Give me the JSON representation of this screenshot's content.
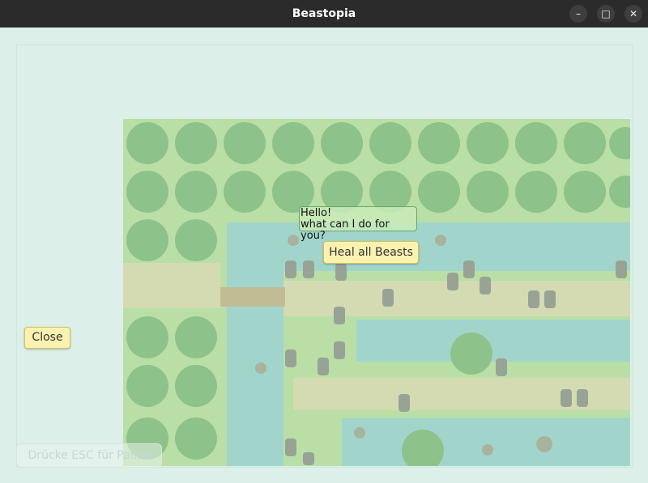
{
  "window": {
    "title": "Beastopia",
    "minimize_label": "–",
    "maximize_label": "□",
    "close_label": "✕"
  },
  "dialog": {
    "line1": "Hello!",
    "line2": "what can I do for you?",
    "heal_button": "Heal all Beasts"
  },
  "close_button": "Close",
  "pause_hint": "Drücke ESC für Pause",
  "colors": {
    "titlebar": "#2b2b2b",
    "background": "#dcefe8",
    "button_fill": "#fbf2b0",
    "bubble_border": "#6aa56a"
  }
}
